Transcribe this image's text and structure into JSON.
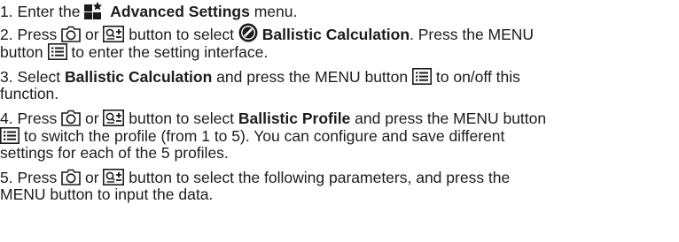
{
  "steps": [
    {
      "num": "1.",
      "t1": "Enter the",
      "b1": "Advanced Settings",
      "t2": "menu."
    },
    {
      "num": "2.",
      "t1": "Press",
      "or": "or",
      "t2": "button to select",
      "b1": "Ballistic Calculation",
      "t3": ". Press the MENU",
      "t4": "button",
      "t5": "to enter the setting interface."
    },
    {
      "num": "3.",
      "t1": "Select",
      "b1": "Ballistic Calculation",
      "t2": "and press the MENU button",
      "t3": "to on/off this",
      "t4": "function."
    },
    {
      "num": "4.",
      "t1": "Press",
      "or": "or",
      "t2": "button to select",
      "b1": "Ballistic Profile",
      "t3": "and press the MENU button",
      "t4": "to switch the profile (from 1 to 5). You can configure and save different",
      "t5": "settings for each of the 5 profiles."
    },
    {
      "num": "5.",
      "t1": "Press",
      "or": "or",
      "t2": "button to select the following parameters, and press the",
      "t3": "MENU button to input the data."
    }
  ],
  "icons": {
    "settings": "advanced-settings-icon",
    "camera": "camera-button-icon",
    "zoom": "zoom-button-icon",
    "ballistic": "ballistic-calculation-icon",
    "menu": "menu-button-icon"
  }
}
